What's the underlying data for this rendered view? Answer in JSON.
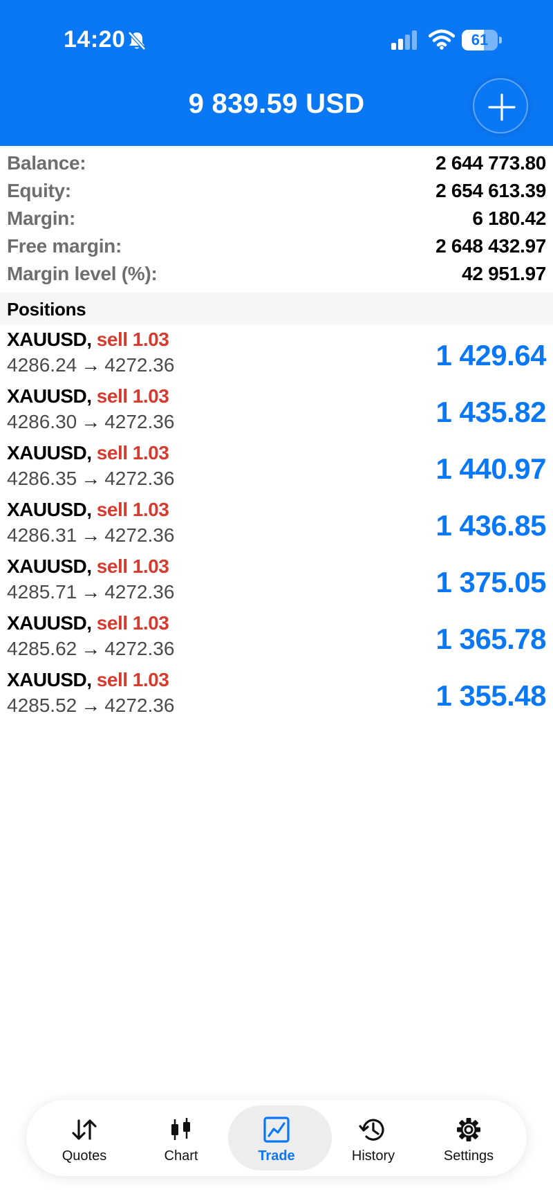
{
  "status_bar": {
    "time": "14:20",
    "battery_level": "61",
    "battery_fraction": 0.61,
    "icons": [
      "bell-slash-icon",
      "cellular-signal-icon",
      "wifi-icon",
      "battery-icon"
    ]
  },
  "header": {
    "title": "9 839.59 USD",
    "add_icon": "plus-icon",
    "background_color": "#0a78f5"
  },
  "summary": [
    {
      "label": "Balance:",
      "value": "2 644 773.80"
    },
    {
      "label": "Equity:",
      "value": "2 654 613.39"
    },
    {
      "label": "Margin:",
      "value": "6 180.42"
    },
    {
      "label": "Free margin:",
      "value": "2 648 432.97"
    },
    {
      "label": "Margin level (%):",
      "value": "42 951.97"
    }
  ],
  "positions": {
    "title": "Positions",
    "items": [
      {
        "symbol": "XAUUSD",
        "type": "sell 1.03",
        "open": "4286.24",
        "arrow": "→",
        "current": "4272.36",
        "profit": "1 429.64"
      },
      {
        "symbol": "XAUUSD",
        "type": "sell 1.03",
        "open": "4286.30",
        "arrow": "→",
        "current": "4272.36",
        "profit": "1 435.82"
      },
      {
        "symbol": "XAUUSD",
        "type": "sell 1.03",
        "open": "4286.35",
        "arrow": "→",
        "current": "4272.36",
        "profit": "1 440.97"
      },
      {
        "symbol": "XAUUSD",
        "type": "sell 1.03",
        "open": "4286.31",
        "arrow": "→",
        "current": "4272.36",
        "profit": "1 436.85"
      },
      {
        "symbol": "XAUUSD",
        "type": "sell 1.03",
        "open": "4285.71",
        "arrow": "→",
        "current": "4272.36",
        "profit": "1 375.05"
      },
      {
        "symbol": "XAUUSD",
        "type": "sell 1.03",
        "open": "4285.62",
        "arrow": "→",
        "current": "4272.36",
        "profit": "1 365.78"
      },
      {
        "symbol": "XAUUSD",
        "type": "sell 1.03",
        "open": "4285.52",
        "arrow": "→",
        "current": "4272.36",
        "profit": "1 355.48"
      }
    ]
  },
  "tab_bar": {
    "active": "Trade",
    "tabs": [
      {
        "label": "Quotes",
        "icon": "quotes-arrows-icon"
      },
      {
        "label": "Chart",
        "icon": "candlestick-chart-icon"
      },
      {
        "label": "Trade",
        "icon": "trade-chart-icon"
      },
      {
        "label": "History",
        "icon": "history-clock-icon"
      },
      {
        "label": "Settings",
        "icon": "gear-icon"
      }
    ]
  },
  "colors": {
    "accent": "#0a78f5",
    "sell": "#d73a2f",
    "label_gray": "#6e6e6e"
  }
}
